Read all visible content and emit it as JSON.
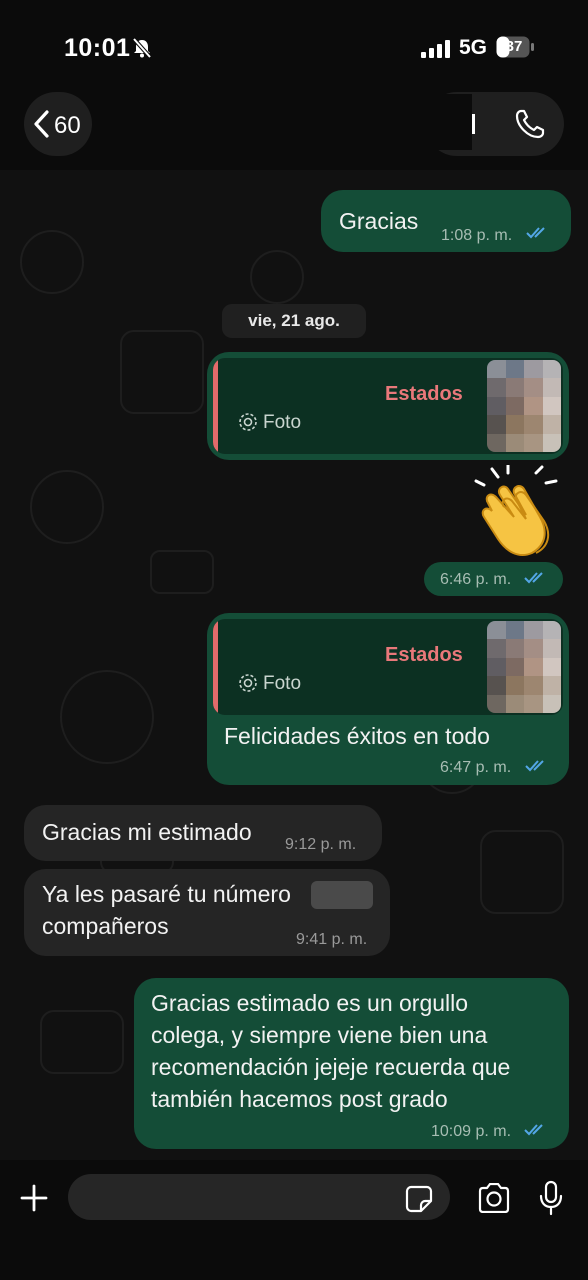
{
  "status_bar": {
    "time": "10:01",
    "network": "5G",
    "battery": "37"
  },
  "header": {
    "back_count": "60"
  },
  "date_separator": "vie, 21 ago.",
  "messages": [
    {
      "text": "Gracias",
      "time": "1:08 p. m."
    },
    {
      "quote_title": "Estados",
      "quote_type": "Foto",
      "time": "6:46 p. m.",
      "emoji": "clapping-hands"
    },
    {
      "quote_title": "Estados",
      "quote_type": "Foto",
      "text": "Felicidades éxitos en todo",
      "time": "6:47 p. m."
    },
    {
      "text": "Gracias mi estimado",
      "time": "9:12 p. m."
    },
    {
      "text_line1": "Ya les pasaré tu número",
      "text_line2": "compañeros",
      "time": "9:41 p. m."
    },
    {
      "text_lines": [
        "Gracias estimado es un orgullo",
        "colega, y siempre viene bien una",
        "recomendación jejeje recuerda que",
        "también hacemos post grado"
      ],
      "time": "10:09 p. m."
    }
  ],
  "colors": {
    "outgoing": "#144d37",
    "incoming": "#252525",
    "quote_accent": "#e26b6b",
    "read_ticks": "#53a6e6"
  },
  "icons": [
    "muted-bell-icon",
    "signal-icon",
    "battery-icon",
    "back-chevron-icon",
    "phone-icon",
    "camera-glyph-icon",
    "double-check-icon",
    "plus-icon",
    "sticker-icon",
    "camera-icon",
    "microphone-icon"
  ]
}
